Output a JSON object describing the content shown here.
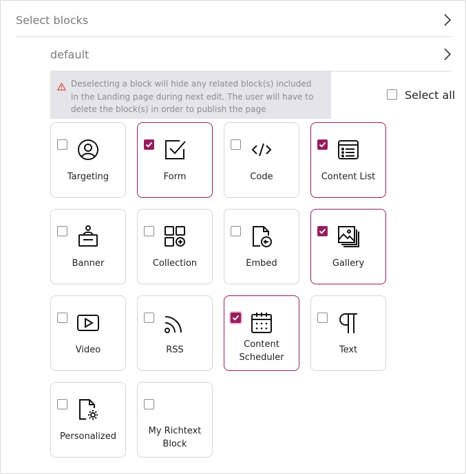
{
  "header": {
    "title": "Select blocks"
  },
  "subheader": {
    "title": "default"
  },
  "warning": {
    "text_lines": [
      "Deselecting a block will hide any related block(s) included",
      "in the Landing page during next edit. The user will have to",
      "delete the block(s) in order to publish the page"
    ]
  },
  "select_all": {
    "label": "Select all",
    "checked": false
  },
  "colors": {
    "accent": "#951e5c",
    "selected_border": "#8e2061",
    "warning_bg": "#e4e4ea",
    "warning_icon": "#d94c3d"
  },
  "blocks": [
    {
      "label": "Targeting",
      "icon": "targeting-icon",
      "checked": false
    },
    {
      "label": "Form",
      "icon": "form-icon",
      "checked": true
    },
    {
      "label": "Code",
      "icon": "code-icon",
      "checked": false
    },
    {
      "label": "Content List",
      "icon": "content-list-icon",
      "checked": true
    },
    {
      "label": "Banner",
      "icon": "banner-icon",
      "checked": false
    },
    {
      "label": "Collection",
      "icon": "collection-icon",
      "checked": false
    },
    {
      "label": "Embed",
      "icon": "embed-icon",
      "checked": false
    },
    {
      "label": "Gallery",
      "icon": "gallery-icon",
      "checked": true
    },
    {
      "label": "Video",
      "icon": "video-icon",
      "checked": false
    },
    {
      "label": "RSS",
      "icon": "rss-icon",
      "checked": false
    },
    {
      "label": "Content Scheduler",
      "label_lines": [
        "Content",
        "Scheduler"
      ],
      "icon": "calendar-icon",
      "checked": true
    },
    {
      "label": "Text",
      "icon": "pilcrow-icon",
      "checked": false
    },
    {
      "label": "Personalized",
      "icon": "personalized-icon",
      "checked": false
    },
    {
      "label": "My Richtext Block",
      "label_lines": [
        "My Richtext",
        "Block"
      ],
      "icon": "",
      "checked": false
    }
  ]
}
